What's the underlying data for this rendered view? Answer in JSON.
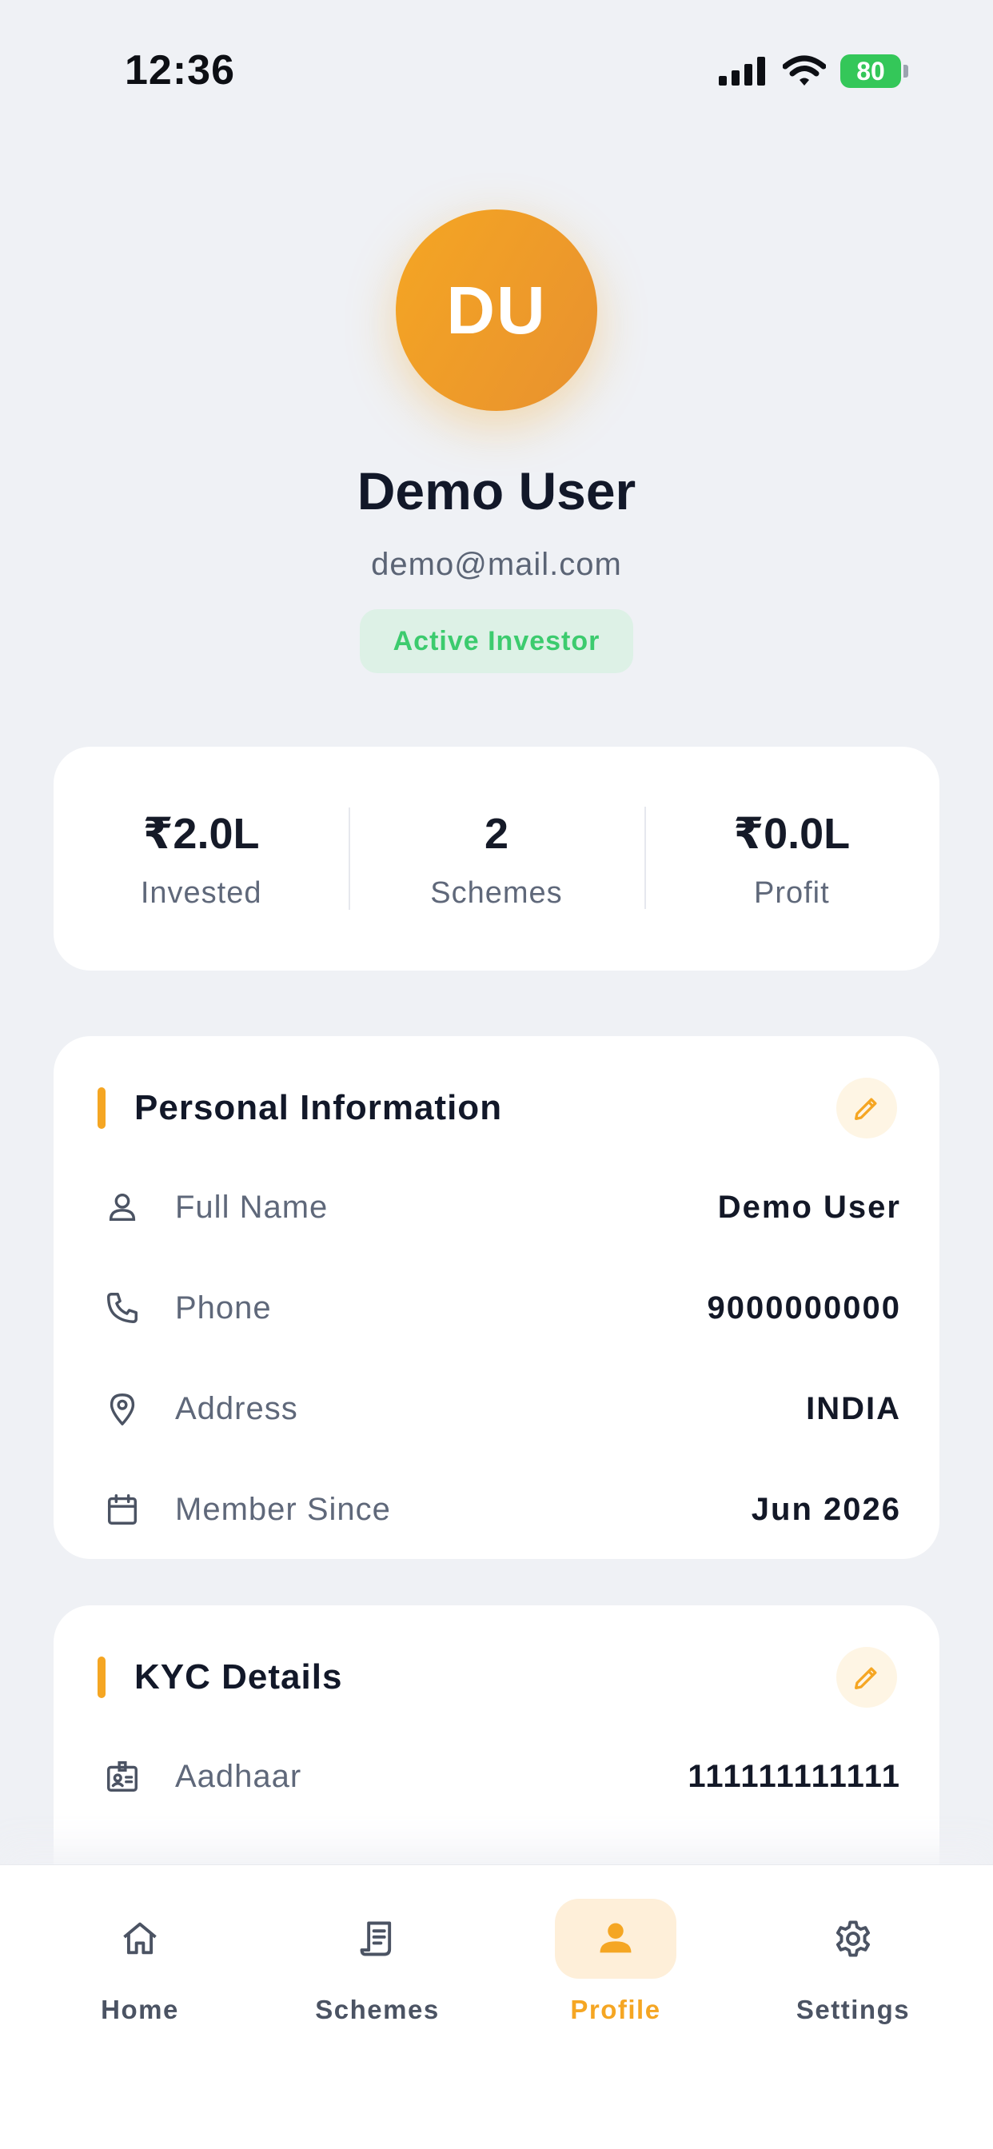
{
  "status_bar": {
    "time": "12:36",
    "battery": "80",
    "icons": [
      "cellular-signal-icon",
      "wifi-icon",
      "battery-charging-icon"
    ]
  },
  "profile": {
    "initials": "DU",
    "name": "Demo User",
    "email": "demo@mail.com",
    "badge": "Active Investor"
  },
  "stats": [
    {
      "value": "₹2.0L",
      "label": "Invested"
    },
    {
      "value": "2",
      "label": "Schemes"
    },
    {
      "value": "₹0.0L",
      "label": "Profit"
    }
  ],
  "personal_info": {
    "title": "Personal Information",
    "rows": [
      {
        "icon": "person-icon",
        "label": "Full Name",
        "value": "Demo User"
      },
      {
        "icon": "phone-icon",
        "label": "Phone",
        "value": "9000000000"
      },
      {
        "icon": "location-pin-icon",
        "label": "Address",
        "value": "INDIA"
      },
      {
        "icon": "calendar-icon",
        "label": "Member Since",
        "value": "Jun 2026"
      }
    ]
  },
  "kyc": {
    "title": "KYC Details",
    "rows": [
      {
        "icon": "id-card-icon",
        "label": "Aadhaar",
        "value": "111111111111"
      }
    ]
  },
  "nav": {
    "active": "Profile",
    "items": [
      {
        "icon": "home-icon",
        "label": "Home"
      },
      {
        "icon": "document-icon",
        "label": "Schemes"
      },
      {
        "icon": "person-icon",
        "label": "Profile"
      },
      {
        "icon": "gear-icon",
        "label": "Settings"
      }
    ]
  },
  "colors": {
    "accent": "#F5A623",
    "background": "#EFF1F5",
    "badge_text": "#3CCB6E",
    "badge_bg": "#DDF1E6",
    "battery": "#34C759"
  }
}
